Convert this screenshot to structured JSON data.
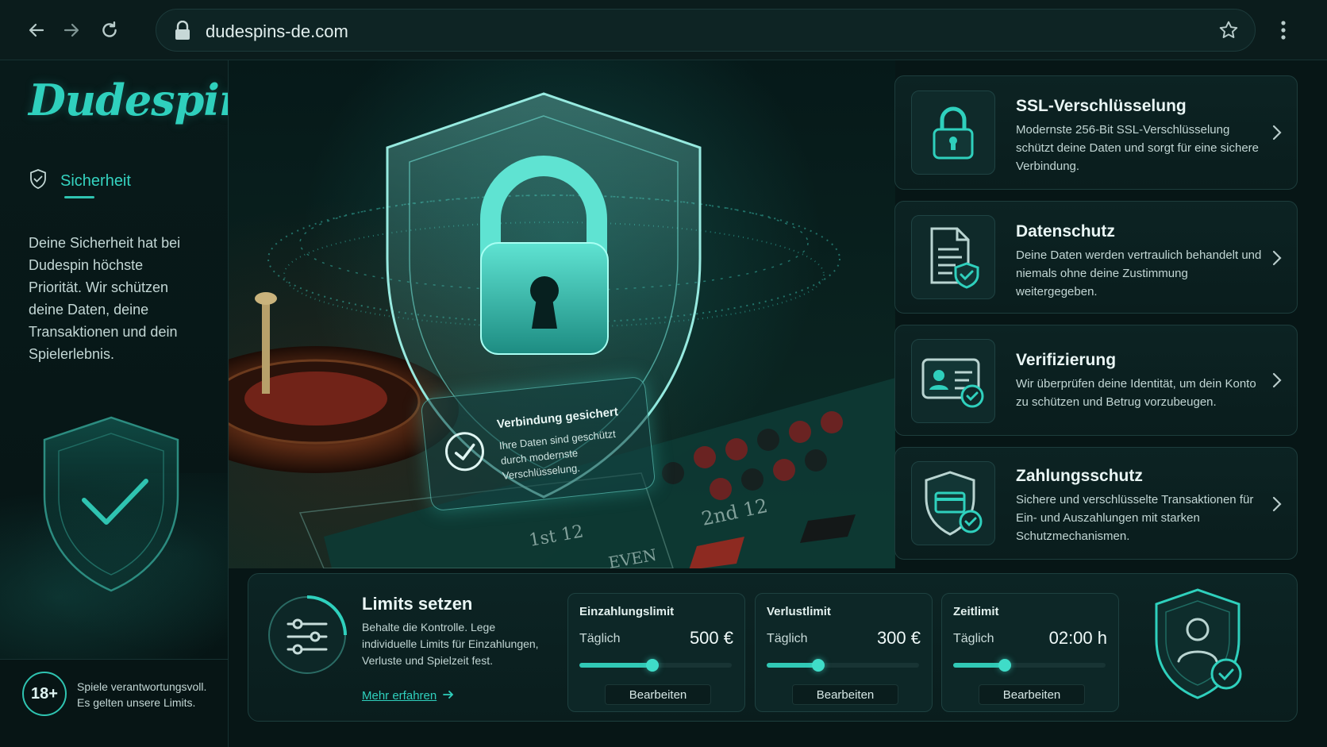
{
  "browser": {
    "url": "dudespins-de.com",
    "icons": [
      "back-arrow-icon",
      "forward-arrow-icon",
      "reload-icon",
      "lock-icon",
      "star-icon",
      "menu-dots-icon"
    ]
  },
  "sidebar": {
    "logo": "Dudespin",
    "nav_label": "Sicherheit",
    "intro": "Deine Sicherheit hat bei Dudespin höchste Priorität. Wir schützen deine Daten, deine Transaktionen und dein Spielerlebnis.",
    "age_badge": "18+",
    "footer_text": "Spiele verantwortungsvoll. Es gelten unsere Limits."
  },
  "hero": {
    "card_title": "Verbindung gesichert",
    "card_text": "Ihre Daten sind geschützt durch modernste Verschlüsselung.",
    "table_labels": [
      "1st 12",
      "2nd 12",
      "EVEN"
    ]
  },
  "features": [
    {
      "title": "SSL-Verschlüsselung",
      "desc": "Modernste 256-Bit SSL-Verschlüsselung schützt deine Daten und sorgt für eine sichere Verbindung.",
      "icon": "padlock-icon"
    },
    {
      "title": "Datenschutz",
      "desc": "Deine Daten werden vertraulich behandelt und niemals ohne deine Zustimmung weitergegeben.",
      "icon": "document-shield-icon"
    },
    {
      "title": "Verifizierung",
      "desc": "Wir überprüfen deine Identität, um dein Konto zu schützen und Betrug vorzubeugen.",
      "icon": "id-card-check-icon"
    },
    {
      "title": "Zahlungsschutz",
      "desc": "Sichere und verschlüsselte Transaktionen für Ein- und Auszahlungen mit starken Schutzmechanismen.",
      "icon": "card-shield-icon"
    }
  ],
  "limits": {
    "title": "Limits setzen",
    "desc": "Behalte die Kontrolle. Lege individuelle Limits für Einzahlungen, Verluste und Spielzeit fest.",
    "more_link": "Mehr erfahren",
    "items": [
      {
        "name": "Einzahlungslimit",
        "period": "Täglich",
        "value": "500 €",
        "level": 0.48,
        "button": "Bearbeiten"
      },
      {
        "name": "Verlustlimit",
        "period": "Täglich",
        "value": "300 €",
        "level": 0.34,
        "button": "Bearbeiten"
      },
      {
        "name": "Zeitlimit",
        "period": "Täglich",
        "value": "02:00 h",
        "level": 0.34,
        "button": "Bearbeiten"
      }
    ]
  },
  "colors": {
    "accent": "#2fd0bd",
    "background": "#071616",
    "panel": "#0c2323",
    "border": "#1d3d3c"
  }
}
